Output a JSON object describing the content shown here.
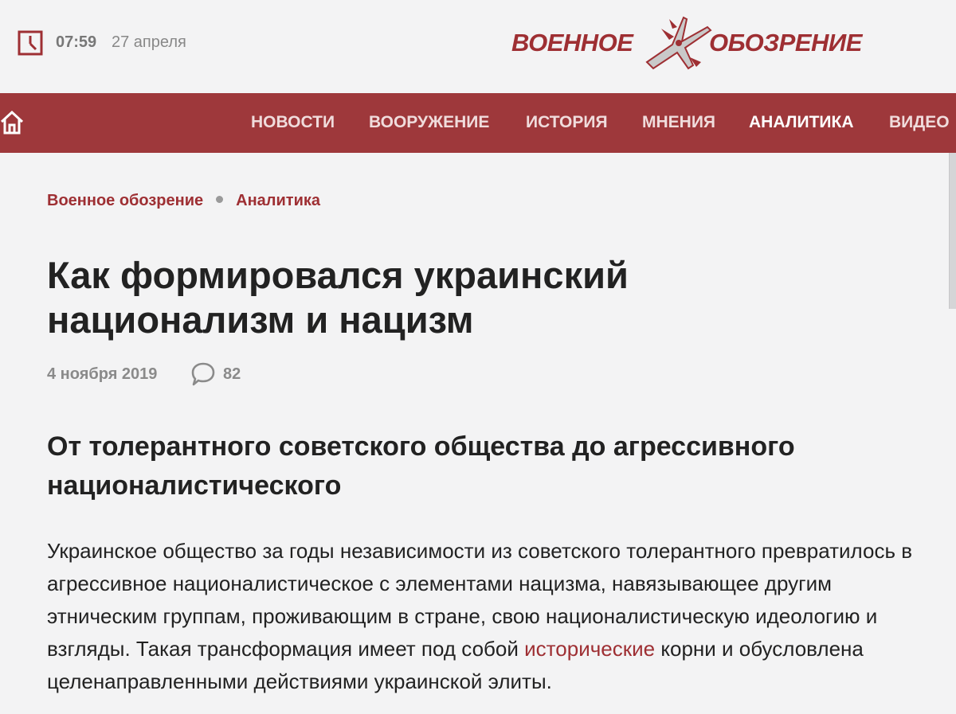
{
  "header": {
    "time": "07:59",
    "date": "27 апреля",
    "logo_left": "ВОЕННОЕ",
    "logo_right": "ОБОЗРЕНИЕ"
  },
  "nav": {
    "items": [
      {
        "label": "НОВОСТИ"
      },
      {
        "label": "ВООРУЖЕНИЕ"
      },
      {
        "label": "ИСТОРИЯ"
      },
      {
        "label": "МНЕНИЯ"
      },
      {
        "label": "АНАЛИТИКА"
      },
      {
        "label": "ВИДЕО"
      }
    ],
    "active": "АНАЛИТИКА"
  },
  "breadcrumb": {
    "items": [
      {
        "label": "Военное обозрение"
      },
      {
        "label": "Аналитика"
      }
    ]
  },
  "article": {
    "title": "Как формировался украинский национализм и нацизм",
    "date": "4 ноября 2019",
    "comments": "82",
    "subtitle": "От толерантного советского общества до агрессивного националистического",
    "body_before_link": "Украинское общество за годы независимости из советского толерантного превратилось в агрессивное националистическое с элементами нацизма, навязывающее другим этническим группам, проживающим в стране, свою националистическую идеологию и взгляды. Такая трансформация имеет под собой ",
    "body_link": "исторические",
    "body_after_link": " корни и обусловлена целенаправленными действиями украинской элиты."
  },
  "colors": {
    "brand": "#9e2f33",
    "navbar": "#9e383b",
    "background": "#f3f3f4",
    "text": "#222222",
    "muted": "#8a8a8a"
  },
  "icons": {
    "clock": "clock-icon",
    "home": "home-icon",
    "comment": "comment-bubble-icon",
    "logo": "fighter-jet-icon"
  }
}
